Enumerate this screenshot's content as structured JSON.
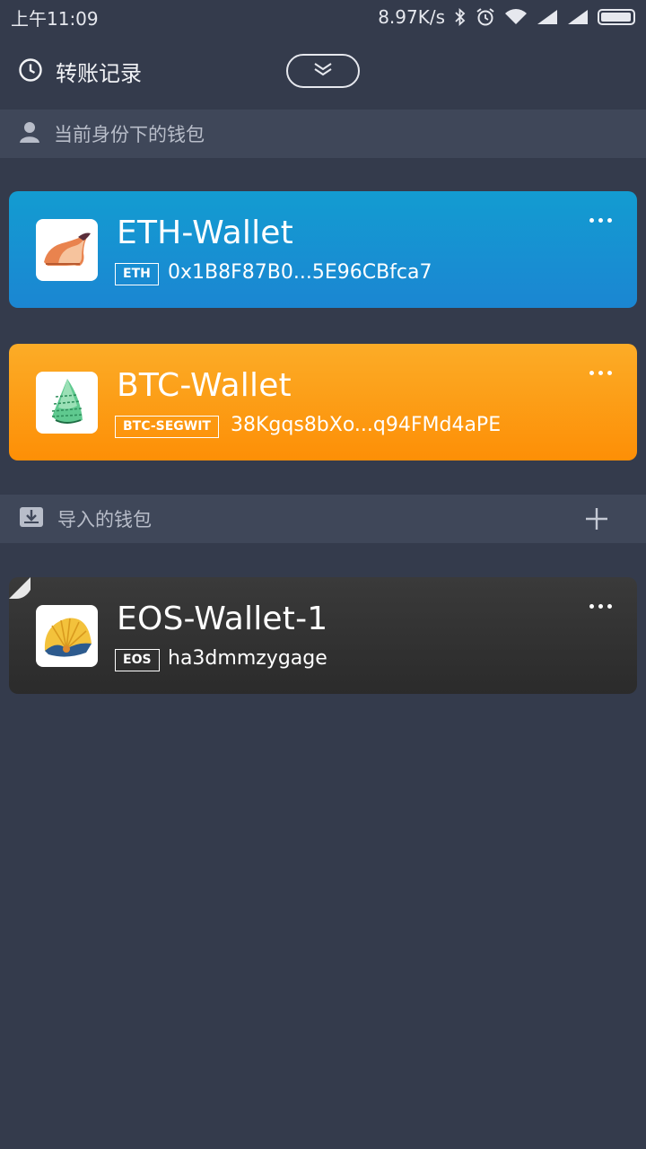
{
  "status_bar": {
    "time": "上午11:09",
    "speed": "8.97K/s",
    "icons": [
      "bluetooth-icon",
      "alarm-icon",
      "wifi-icon",
      "signal-icon",
      "signal-icon",
      "battery-icon"
    ]
  },
  "header": {
    "history_label": "转账记录",
    "history_icon": "clock-icon",
    "collapse_icon": "double-chevron-down-icon"
  },
  "sections": {
    "identity": {
      "label": "当前身份下的钱包",
      "icon": "person-icon"
    },
    "imported": {
      "label": "导入的钱包",
      "icon": "download-icon",
      "action_icon": "plus-icon"
    }
  },
  "wallets": [
    {
      "name": "ETH-Wallet",
      "tag": "ETH",
      "address": "0x1B8F87B0...5E96CBfca7",
      "color": "#139cd1"
    },
    {
      "name": "BTC-Wallet",
      "tag": "BTC-SEGWIT",
      "address": "38Kgqs8bXo...q94FMd4aPE",
      "color": "#fd9a14"
    },
    {
      "name": "EOS-Wallet-1",
      "tag": "EOS",
      "address": "ha3dmmzygage",
      "color": "#333333"
    }
  ],
  "colors": {
    "background": "#343b4c",
    "section_bar": "#3f4759"
  }
}
